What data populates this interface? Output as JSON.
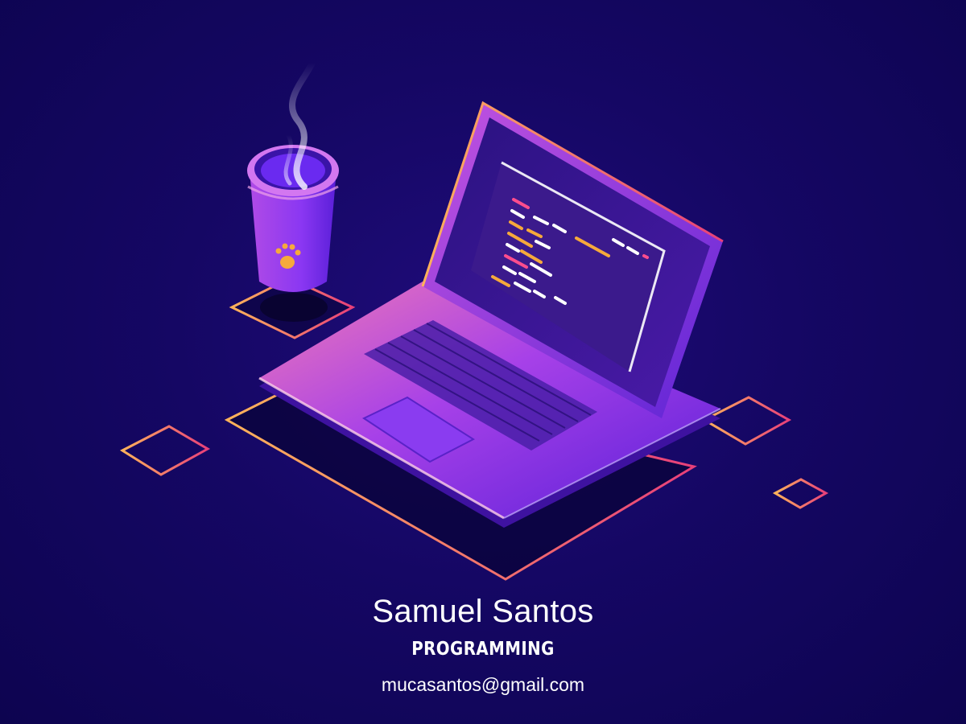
{
  "profile": {
    "name": "Samuel Santos",
    "role": "PROGRAMMING",
    "email": "mucasantos@gmail.com"
  },
  "illustration": {
    "icons": [
      "laptop-icon",
      "coffee-cup-icon",
      "paw-print-icon",
      "steam-icon"
    ],
    "colors": {
      "background": "#150764",
      "outline_gradient_start": "#ffb35a",
      "outline_gradient_end": "#e8407a",
      "laptop_violet": "#7a2cf0",
      "screen_dark": "#3b1a8c",
      "code_pink": "#ff4d8d",
      "code_orange": "#f6a93b",
      "code_white": "#ffffff"
    }
  }
}
